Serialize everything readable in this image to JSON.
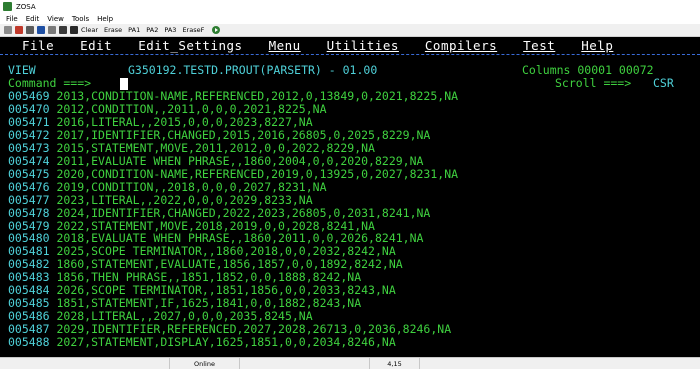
{
  "window": {
    "title": "ZOSA"
  },
  "app_menu": [
    "File",
    "Edit",
    "View",
    "Tools",
    "Help"
  ],
  "toolbar": {
    "buttons": [
      "Clear",
      "Erase",
      "PA1",
      "PA2",
      "PA3",
      "EraseF"
    ]
  },
  "terminal": {
    "menu": [
      "File",
      "Edit",
      "Edit_Settings",
      "Menu",
      "Utilities",
      "Compilers",
      "Test",
      "Help"
    ],
    "mode": "VIEW",
    "dataset": "G350192.TESTD.PROUT(PARSETR) - 01.00",
    "columns_label": "Columns 00001 00072",
    "command_label": "Command ===>",
    "scroll_label": "Scroll ===>",
    "scroll_value": "CSR",
    "rows": [
      {
        "num": "005469",
        "text": "2013,CONDITION-NAME,REFERENCED,2012,0,13849,0,2021,8225,NA"
      },
      {
        "num": "005470",
        "text": "2012,CONDITION,,2011,0,0,0,2021,8225,NA"
      },
      {
        "num": "005471",
        "text": "2016,LITERAL,,2015,0,0,0,2023,8227,NA"
      },
      {
        "num": "005472",
        "text": "2017,IDENTIFIER,CHANGED,2015,2016,26805,0,2025,8229,NA"
      },
      {
        "num": "005473",
        "text": "2015,STATEMENT,MOVE,2011,2012,0,0,2022,8229,NA"
      },
      {
        "num": "005474",
        "text": "2011,EVALUATE WHEN PHRASE,,1860,2004,0,0,2020,8229,NA"
      },
      {
        "num": "005475",
        "text": "2020,CONDITION-NAME,REFERENCED,2019,0,13925,0,2027,8231,NA"
      },
      {
        "num": "005476",
        "text": "2019,CONDITION,,2018,0,0,0,2027,8231,NA"
      },
      {
        "num": "005477",
        "text": "2023,LITERAL,,2022,0,0,0,2029,8233,NA"
      },
      {
        "num": "005478",
        "text": "2024,IDENTIFIER,CHANGED,2022,2023,26805,0,2031,8241,NA"
      },
      {
        "num": "005479",
        "text": "2022,STATEMENT,MOVE,2018,2019,0,0,2028,8241,NA"
      },
      {
        "num": "005480",
        "text": "2018,EVALUATE WHEN PHRASE,,1860,2011,0,0,2026,8241,NA"
      },
      {
        "num": "005481",
        "text": "2025,SCOPE TERMINATOR,,1860,2018,0,0,2032,8242,NA"
      },
      {
        "num": "005482",
        "text": "1860,STATEMENT,EVALUATE,1856,1857,0,0,1892,8242,NA"
      },
      {
        "num": "005483",
        "text": "1856,THEN PHRASE,,1851,1852,0,0,1888,8242,NA"
      },
      {
        "num": "005484",
        "text": "2026,SCOPE TERMINATOR,,1851,1856,0,0,2033,8243,NA"
      },
      {
        "num": "005485",
        "text": "1851,STATEMENT,IF,1625,1841,0,0,1882,8243,NA"
      },
      {
        "num": "005486",
        "text": "2028,LITERAL,,2027,0,0,0,2035,8245,NA"
      },
      {
        "num": "005487",
        "text": "2029,IDENTIFIER,REFERENCED,2027,2028,26713,0,2036,8246,NA"
      },
      {
        "num": "005488",
        "text": "2027,STATEMENT,DISPLAY,1625,1851,0,0,2034,8246,NA"
      }
    ]
  },
  "status": {
    "connection": "Online",
    "cursor_pos": "4,15"
  },
  "colors": {
    "num": "#4fd1d9",
    "text": "#3fd13f",
    "background": "#000000"
  }
}
